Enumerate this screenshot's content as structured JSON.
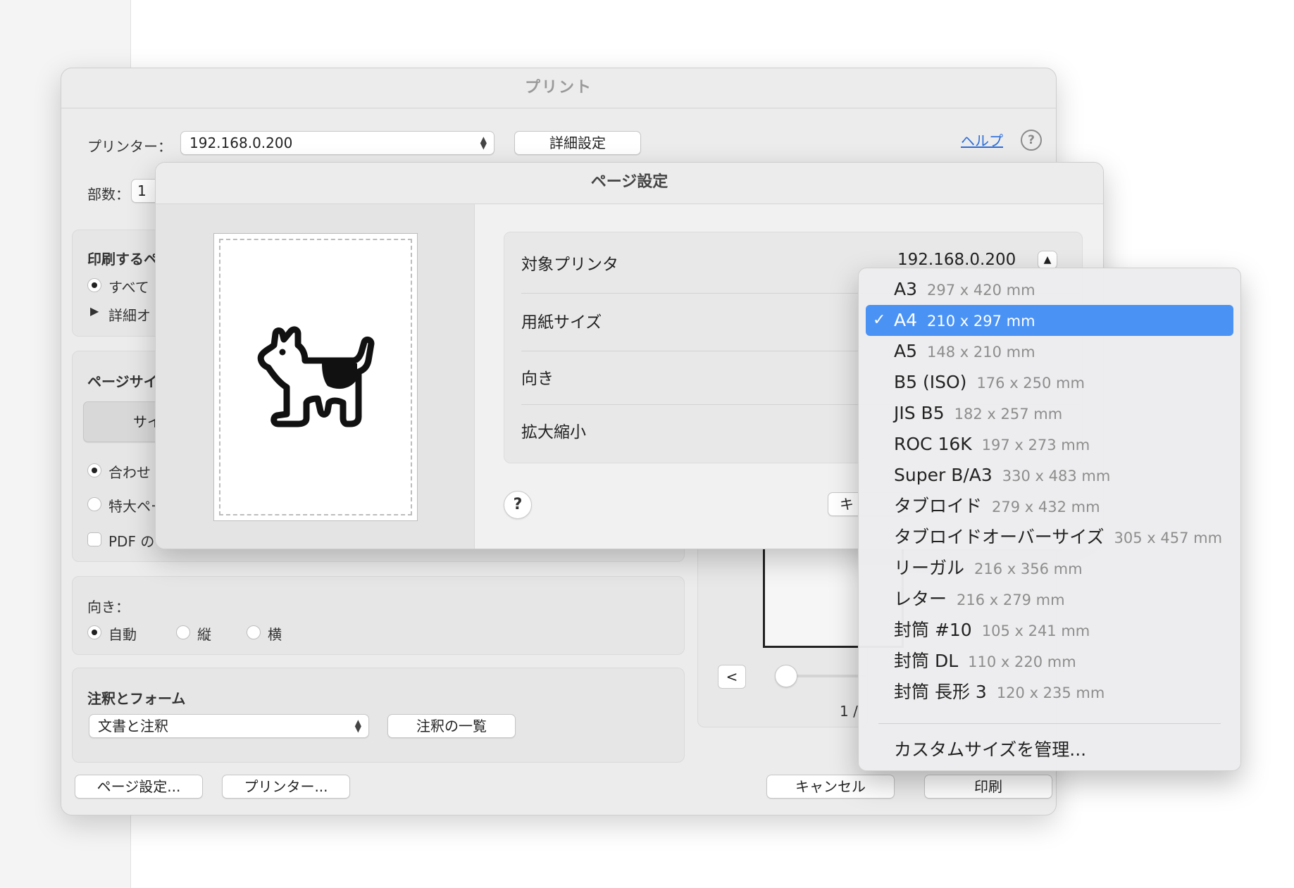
{
  "print_dialog": {
    "title": "プリント",
    "printer_label": "プリンター：",
    "printer_value": "192.168.0.200",
    "details_button": "詳細設定",
    "help_link": "ヘルプ",
    "help_icon": "?",
    "copies_label": "部数：",
    "copies_value": "1",
    "pages_section_title": "印刷するペ",
    "pages_all": "すべて",
    "details_disclosure": "詳細オ",
    "page_size_section_title": "ページサイ",
    "page_size_button": "サイ",
    "fit_option": "合わせ",
    "poster_option": "特大ペー",
    "pdf_option": "PDF の",
    "orientation_label": "向き：",
    "orientation_options": [
      "自動",
      "縦",
      "横"
    ],
    "annotations_title": "注釈とフォーム",
    "annotations_value": "文書と注釈",
    "annotations_list_button": "注釈の一覧",
    "page_setup_button": "ページ設定...",
    "printer_button": "プリンター...",
    "cancel_button": "キャンセル",
    "print_button": "印刷",
    "preview_prev": "<",
    "page_counter": "1 /"
  },
  "page_setup": {
    "title": "ページ設定",
    "rows": [
      {
        "label": "対象プリンタ",
        "value": "192.168.0.200"
      },
      {
        "label": "用紙サイズ"
      },
      {
        "label": "向き"
      },
      {
        "label": "拡大縮小"
      }
    ],
    "help_icon": "?",
    "partial_button": "キ"
  },
  "paper_menu": {
    "selected": "A4",
    "items": [
      {
        "name": "A3",
        "dims": "297 x 420 mm"
      },
      {
        "name": "A4",
        "dims": "210 x 297 mm"
      },
      {
        "name": "A5",
        "dims": "148 x 210 mm"
      },
      {
        "name": "B5 (ISO)",
        "dims": "176 x 250 mm"
      },
      {
        "name": "JIS B5",
        "dims": "182 x 257 mm"
      },
      {
        "name": "ROC 16K",
        "dims": "197 x 273 mm"
      },
      {
        "name": "Super B/A3",
        "dims": "330 x 483 mm"
      },
      {
        "name": "タブロイド",
        "dims": "279 x 432 mm"
      },
      {
        "name": "タブロイドオーバーサイズ",
        "dims": "305 x 457 mm"
      },
      {
        "name": "リーガル",
        "dims": "216 x 356 mm"
      },
      {
        "name": "レター",
        "dims": "216 x 279 mm"
      },
      {
        "name": "封筒 #10",
        "dims": "105 x 241 mm"
      },
      {
        "name": "封筒 DL",
        "dims": "110 x 220 mm"
      },
      {
        "name": "封筒 長形 3",
        "dims": "120 x 235 mm"
      }
    ],
    "manage_custom": "カスタムサイズを管理...",
    "check_mark": "✓"
  },
  "colors": {
    "accent": "#4a93f5",
    "link": "#2b6cd8"
  }
}
